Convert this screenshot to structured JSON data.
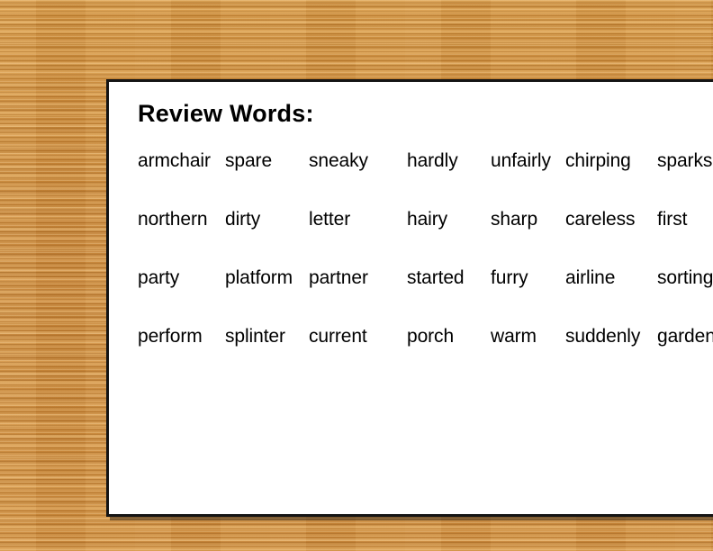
{
  "background": {
    "kind": "wood-desk-texture",
    "base_color": "#D2913F",
    "grain_light": "#E8B775",
    "grain_dark": "#A8692A"
  },
  "slide": {
    "background_color": "#FFFFFF",
    "border_color": "#141414",
    "title": "Review Words:",
    "columns": 7,
    "rows": 4,
    "word_rows": [
      [
        "armchair",
        "spare",
        "sneaky",
        "hardly",
        "unfairly",
        "chirping",
        "sparks"
      ],
      [
        "northern",
        "dirty",
        "letter",
        "hairy",
        "sharp",
        "careless",
        "first"
      ],
      [
        "party",
        "platform",
        "partner",
        "started",
        "furry",
        "airline",
        "sorting"
      ],
      [
        "perform",
        "splinter",
        "current",
        "porch",
        "warm",
        "suddenly",
        "gardener"
      ]
    ]
  }
}
